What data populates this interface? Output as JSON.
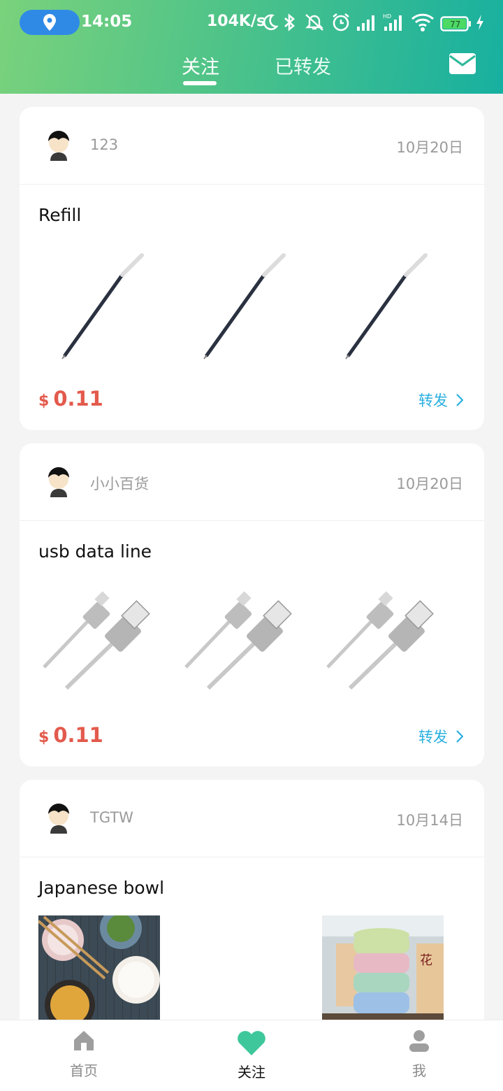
{
  "status_bar": {
    "time": "14:05",
    "net_speed": "104K/s",
    "battery_level": "77",
    "icons": [
      "location-icon",
      "moon-icon",
      "bluetooth-icon",
      "vibrate-off-icon",
      "alarm-icon",
      "signal-icon",
      "signal-hd-icon",
      "wifi-icon",
      "battery-icon",
      "charging-icon"
    ]
  },
  "header": {
    "tabs": [
      {
        "label": "关注",
        "active": true
      },
      {
        "label": "已转发",
        "active": false
      }
    ],
    "mail_icon": "mail-icon",
    "colors": {
      "gradient_start": "#7ad27c",
      "gradient_end": "#17b0a0"
    }
  },
  "feed": [
    {
      "user": "123",
      "date": "10月20日",
      "title": "Refill",
      "product": "pen-refill",
      "currency": "$",
      "price": "0.11",
      "share_label": "转发"
    },
    {
      "user": "小小百货",
      "date": "10月20日",
      "title": "usb data line",
      "product": "usb-cable",
      "currency": "$",
      "price": "0.11",
      "share_label": "转发"
    },
    {
      "user": "TGTW",
      "date": "10月14日",
      "title": "Japanese bowl",
      "product": "bowl"
    }
  ],
  "bottom_nav": [
    {
      "label": "首页",
      "icon": "home-icon",
      "active": false
    },
    {
      "label": "关注",
      "icon": "heart-icon",
      "active": true
    },
    {
      "label": "我",
      "icon": "person-icon",
      "active": false
    }
  ],
  "colors": {
    "price": "#e35a4c",
    "share": "#2ab0e0",
    "accent": "#4ec389"
  }
}
